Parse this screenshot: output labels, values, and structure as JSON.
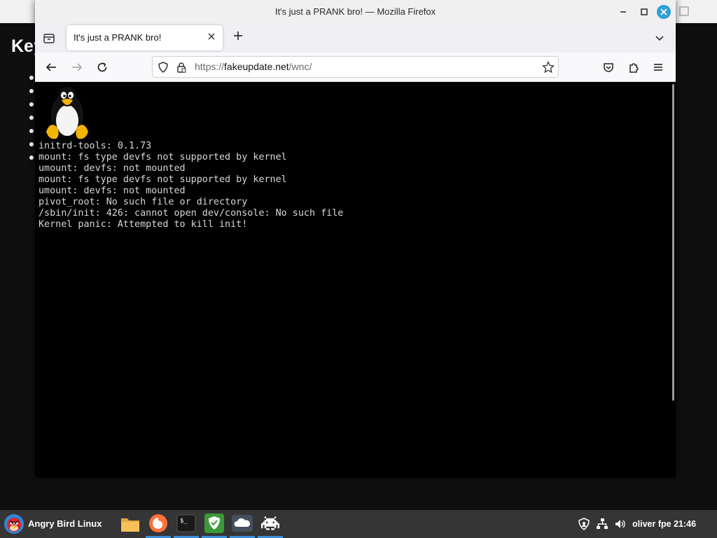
{
  "background_window": {
    "heading": "Key"
  },
  "firefox": {
    "window_title": "It's just a PRANK bro! — Mozilla Firefox",
    "tab": {
      "label": "It's just a PRANK bro!"
    },
    "url": {
      "scheme": "https://",
      "host": "fakeupdate.net",
      "path": "/wnc/"
    }
  },
  "console": {
    "lines": [
      "initrd-tools: 0.1.73",
      "mount: fs type devfs not supported by kernel",
      "umount: devfs: not mounted",
      "mount: fs type devfs not supported by kernel",
      "umount: devfs: not mounted",
      "pivot_root: No such file or directory",
      "/sbin/init: 426: cannot open dev/console: No such file",
      "Kernel panic: Attempted to kill init!"
    ]
  },
  "taskbar": {
    "start_label": "Angry Bird Linux",
    "apps": [
      "files-icon",
      "firefox-icon",
      "terminal-icon",
      "shield-icon",
      "cloud-icon",
      "space-invader-icon"
    ],
    "tray": {
      "user": "oliver fpe",
      "time": "21:46"
    }
  },
  "colors": {
    "accent": "#2f9fd8",
    "taskbar": "#353535",
    "console_text": "#d8d8d8"
  }
}
